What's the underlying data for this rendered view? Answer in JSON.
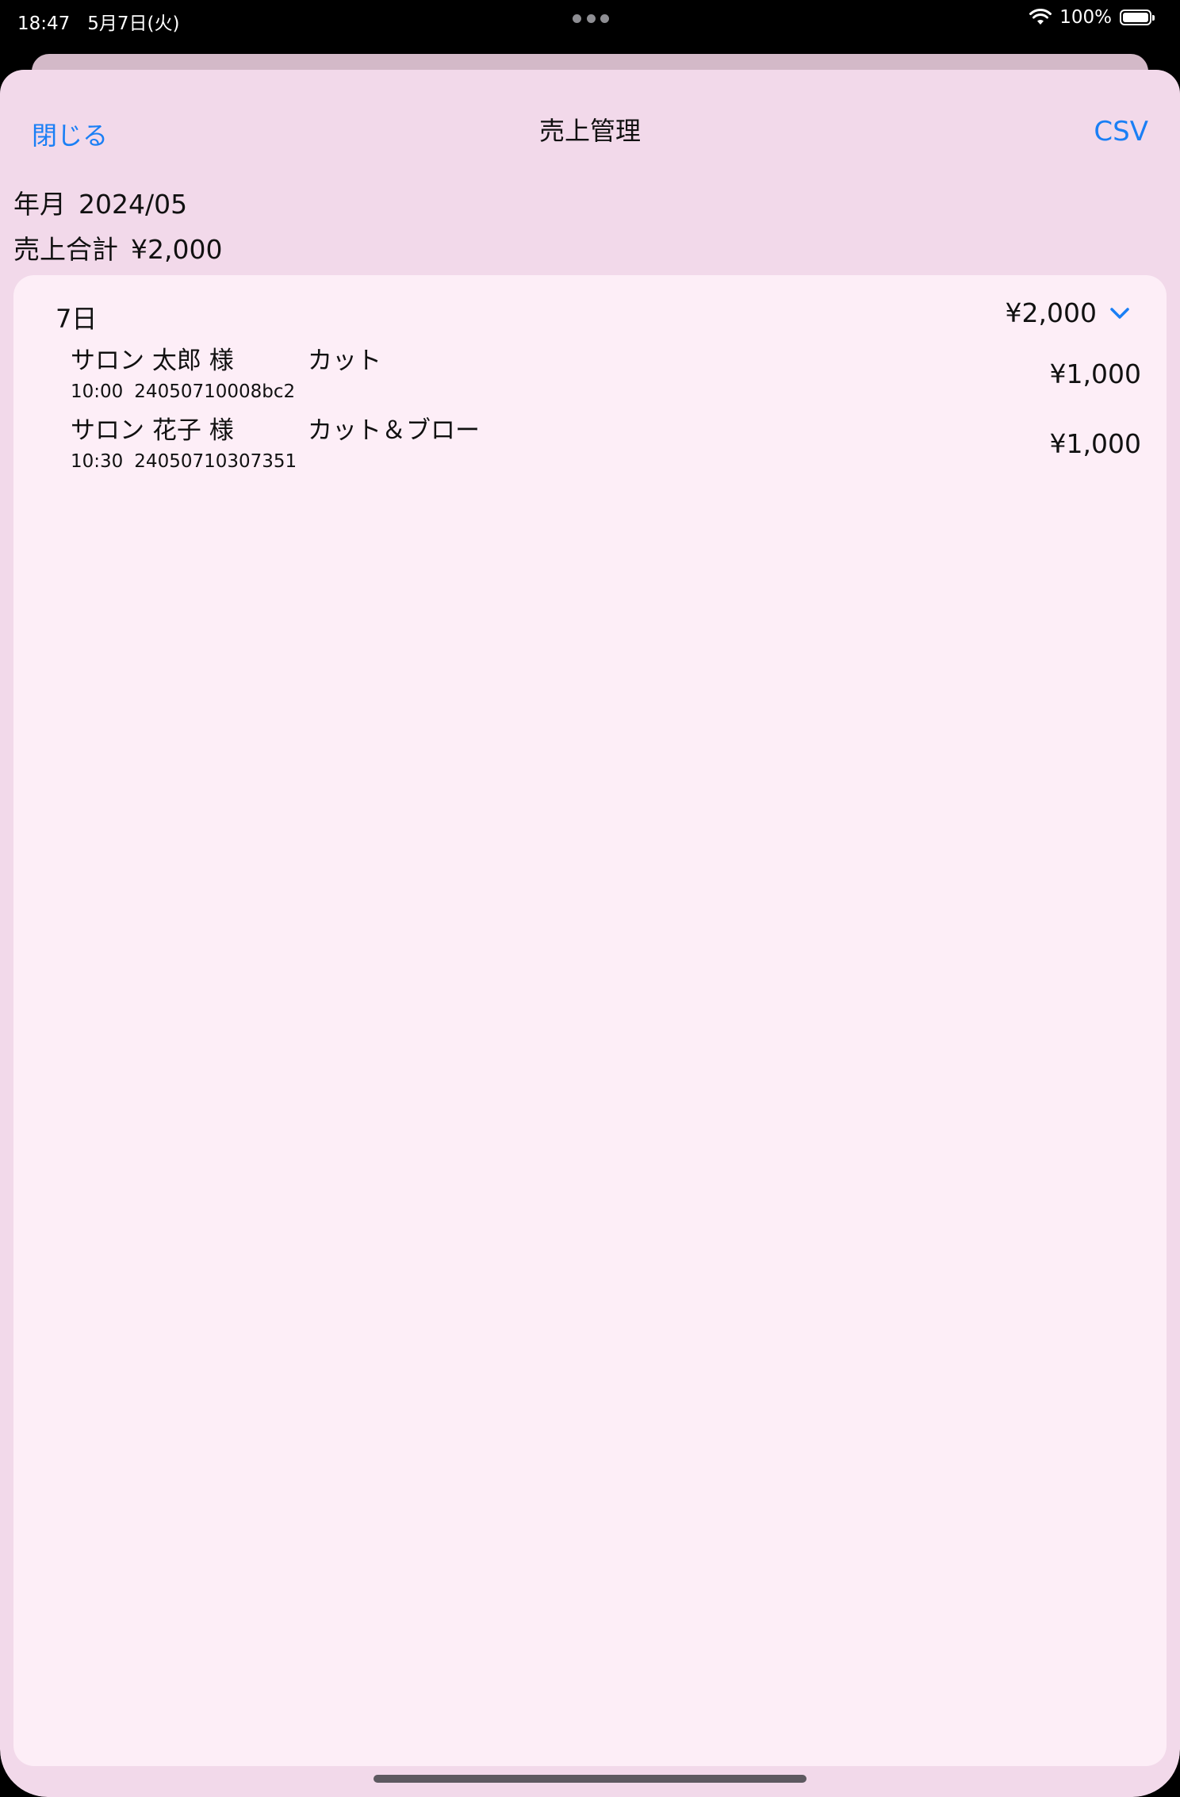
{
  "status_bar": {
    "time": "18:47",
    "date": "5月7日(火)",
    "battery": "100%"
  },
  "nav": {
    "close_label": "閉じる",
    "title": "売上管理",
    "csv_label": "CSV"
  },
  "summary": {
    "month_label": "年月",
    "month_value": "2024/05",
    "total_label": "売上合計",
    "total_value": "¥2,000"
  },
  "day_group": {
    "day_label": "7日",
    "day_total": "¥2,000",
    "entries": [
      {
        "name": "サロン 太郎 様",
        "menu": "カット",
        "time": "10:00",
        "id": "24050710008bc2",
        "price": "¥1,000"
      },
      {
        "name": "サロン 花子 様",
        "menu": "カット＆ブロー",
        "time": "10:30",
        "id": "24050710307351",
        "price": "¥1,000"
      }
    ]
  },
  "colors": {
    "sheet_bg": "#f2d9ea",
    "card_bg": "#fdeef7",
    "accent": "#1a7ff5"
  }
}
